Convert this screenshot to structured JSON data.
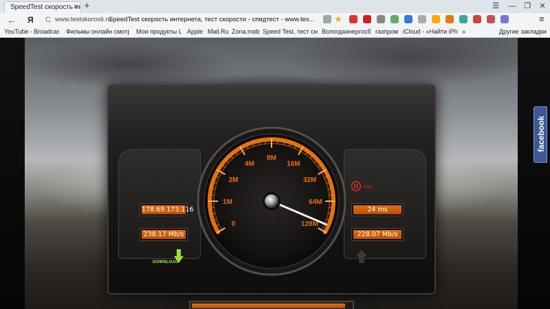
{
  "browser": {
    "tab_title": "SpeedTest скорость инте",
    "new_tab_glyph": "+",
    "window_controls": [
      "☰",
      "—",
      "❐",
      "✕"
    ],
    "url_domain": "www.testskorosti.ru",
    "url_title": "SpeedTest скорость интернета, тест скорости - спидтест - www.tes...",
    "logo": "Я",
    "back_glyph": "←",
    "reload_glyph": "C",
    "menu_glyph": "≡",
    "extensions": [
      {
        "name": "ext-ugo",
        "color": "#d33"
      },
      {
        "name": "ext-mail",
        "color": "#c22"
      },
      {
        "name": "ext-skype",
        "color": "#888"
      },
      {
        "name": "ext-opera",
        "color": "#6a6"
      },
      {
        "name": "ext-shield",
        "color": "#3a7bd5"
      },
      {
        "name": "ext-gem",
        "color": "#aaa"
      },
      {
        "name": "ext-bolt",
        "color": "#fa0"
      },
      {
        "name": "ext-ok",
        "color": "#e27c0e"
      },
      {
        "name": "ext-g",
        "color": "#3a9"
      },
      {
        "name": "ext-m",
        "color": "#c44"
      },
      {
        "name": "ext-pen",
        "color": "#b55"
      },
      {
        "name": "ext-cube",
        "color": "#77c"
      }
    ]
  },
  "bookmarks": [
    "YouTube - Broadcast Y",
    "Фильмы онлайн смотр",
    "Мои продукты LG: Ли",
    "Apple",
    "Mail.Ru",
    "Zona.mobi",
    "Speed Test, тест скоро",
    "Вологдаэнергосбыт",
    "газпром",
    "iCloud - «Найти iPhone",
    "»",
    "Другие закладки"
  ],
  "speedtest": {
    "ip_address": "178.69.173.116",
    "download_speed": "238.17 Mb/s",
    "ping": "24 ms",
    "upload_speed": "228.07 Mb/s",
    "download_label": "DOWNLOAD",
    "ping_label": "PING",
    "gauge_ticks": [
      "0",
      "1M",
      "2M",
      "4M",
      "8M",
      "16M",
      "32M",
      "64M",
      "128M"
    ],
    "needle_value": "128M",
    "progress": 0.96,
    "colors": {
      "accent": "#e8700c",
      "ping": "#e03020",
      "download": "#a9e34b"
    }
  },
  "facebook_tab": "facebook"
}
